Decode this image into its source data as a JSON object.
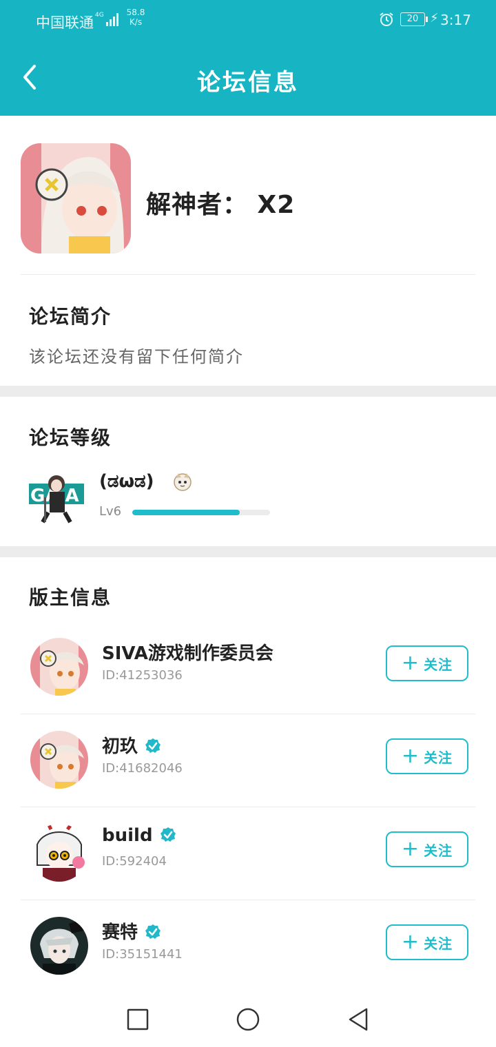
{
  "status_bar": {
    "carrier": "中国联通",
    "network": "4G",
    "speed_value": "58.8",
    "speed_unit": "K/s",
    "battery": "20",
    "time": "3:17"
  },
  "header": {
    "title": "论坛信息"
  },
  "forum": {
    "name": "解神者： X2"
  },
  "intro": {
    "title": "论坛简介",
    "text": "该论坛还没有留下任何简介"
  },
  "level": {
    "title": "论坛等级",
    "name": "(ಡωಡ)",
    "level_label": "Lv6",
    "progress": 0.78
  },
  "moderators": {
    "title": "版主信息",
    "follow_label": "关注",
    "items": [
      {
        "name": "SIVA游戏制作委员会",
        "id": "ID:41253036",
        "verified": false
      },
      {
        "name": "初玖",
        "id": "ID:41682046",
        "verified": true
      },
      {
        "name": "build",
        "id": "ID:592404",
        "verified": true
      },
      {
        "name": "赛特",
        "id": "ID:35151441",
        "verified": true
      }
    ]
  },
  "colors": {
    "accent": "#17b5c3",
    "button": "#1fbccb"
  }
}
